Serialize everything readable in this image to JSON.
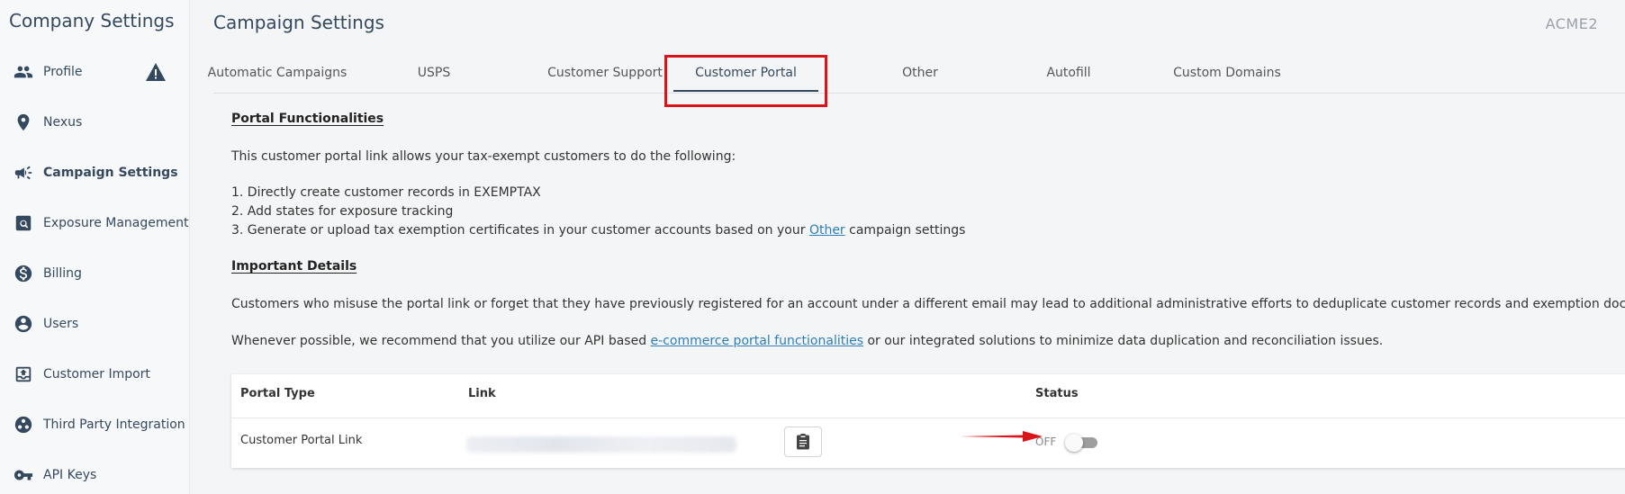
{
  "sidebar": {
    "title": "Company Settings",
    "items": [
      {
        "label": "Profile",
        "icon": "users-icon"
      },
      {
        "label": "Nexus",
        "icon": "map-pin-icon"
      },
      {
        "label": "Campaign Settings",
        "icon": "megaphone-icon"
      },
      {
        "label": "Exposure Management",
        "icon": "search-doc-icon"
      },
      {
        "label": "Billing",
        "icon": "dollar-icon"
      },
      {
        "label": "Users",
        "icon": "user-circle-icon"
      },
      {
        "label": "Customer Import",
        "icon": "upload-icon"
      },
      {
        "label": "Third Party Integration",
        "icon": "integration-icon"
      },
      {
        "label": "API Keys",
        "icon": "key-icon"
      }
    ],
    "active_index": 2,
    "warning_color": "#34495e"
  },
  "header": {
    "title": "Campaign Settings",
    "account": "ACME2"
  },
  "tabs": [
    {
      "label": "Automatic Campaigns"
    },
    {
      "label": "USPS"
    },
    {
      "label": "Customer Support"
    },
    {
      "label": "Customer Portal"
    },
    {
      "label": "Other"
    },
    {
      "label": "Autofill"
    },
    {
      "label": "Custom Domains"
    }
  ],
  "active_tab_index": 3,
  "content": {
    "functionalities_heading": "Portal Functionalities",
    "intro": "This customer portal link allows your tax-exempt customers to do the following:",
    "list": [
      "1. Directly create customer records in EXEMPTAX",
      "2. Add states for exposure tracking"
    ],
    "item3_before": "3. Generate or upload tax exemption certificates in your customer accounts based on your ",
    "item3_link": "Other",
    "item3_after": " campaign settings",
    "details_heading": "Important Details",
    "details_para1": "Customers who misuse the portal link or forget that they have previously registered for an account under a different email may lead to additional administrative efforts to deduplicate customer records and exemption documents.",
    "details_para2_before": "Whenever possible, we recommend that you utilize our API based ",
    "details_para2_link": "e-commerce portal functionalities",
    "details_para2_after": " or our integrated solutions to minimize data duplication and reconciliation issues."
  },
  "table": {
    "headers": {
      "type": "Portal Type",
      "link": "Link",
      "status": "Status"
    },
    "row": {
      "type": "Customer Portal Link",
      "status": "OFF"
    }
  },
  "colors": {
    "accent": "#34495e",
    "link": "#2c7fb8",
    "highlight": "#d9141a"
  }
}
